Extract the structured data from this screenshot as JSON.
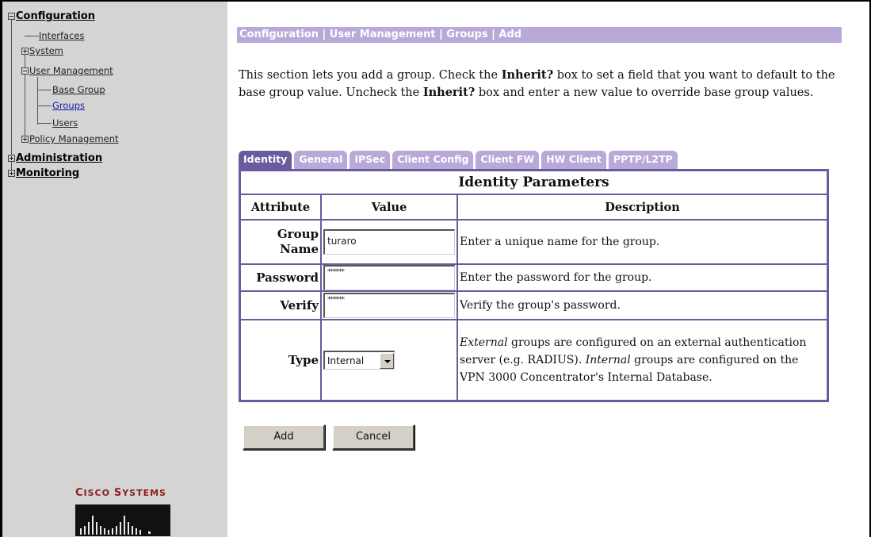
{
  "nav": {
    "configuration": "Configuration",
    "interfaces": "Interfaces",
    "system": "System",
    "user_management": "User Management",
    "base_group": "Base Group",
    "groups": "Groups",
    "users": "Users",
    "policy_management": "Policy Management",
    "administration": "Administration",
    "monitoring": "Monitoring"
  },
  "logo": {
    "text_big1": "C",
    "text1": "ISCO ",
    "text_big2": "S",
    "text2": "YSTEMS"
  },
  "breadcrumb": "Configuration | User Management | Groups | Add",
  "intro": {
    "p1": "This section lets you add a group. Check the ",
    "inherit1": "Inherit?",
    "p2": " box to set a field that you want to default to the base group value. Uncheck the ",
    "inherit2": "Inherit?",
    "p3": " box and enter a new value to override base group values."
  },
  "tabs": [
    "Identity",
    "General",
    "IPSec",
    "Client Config",
    "Client FW",
    "HW Client",
    "PPTP/L2TP"
  ],
  "table": {
    "title": "Identity Parameters",
    "headers": {
      "attribute": "Attribute",
      "value": "Value",
      "description": "Description"
    },
    "rows": {
      "group_name": {
        "label": "Group Name",
        "value": "turaro",
        "desc": "Enter a unique name for the group."
      },
      "password": {
        "label": "Password",
        "value": "******",
        "desc": "Enter the password for the group."
      },
      "verify": {
        "label": "Verify",
        "value": "******",
        "desc": "Verify the group's password."
      },
      "type": {
        "label": "Type",
        "value": "Internal",
        "desc_ext": "External",
        "desc_1": " groups are configured on an external authentication server (e.g. RADIUS). ",
        "desc_int": "Internal",
        "desc_2": " groups are configured on the VPN 3000 Concentrator's Internal Database."
      }
    }
  },
  "buttons": {
    "add": "Add",
    "cancel": "Cancel"
  },
  "colors": {
    "accent": "#b8a9d8",
    "accent_dark": "#6a5a9e",
    "nav_bg": "#d4d4d4",
    "logo": "#8a1d1d"
  }
}
